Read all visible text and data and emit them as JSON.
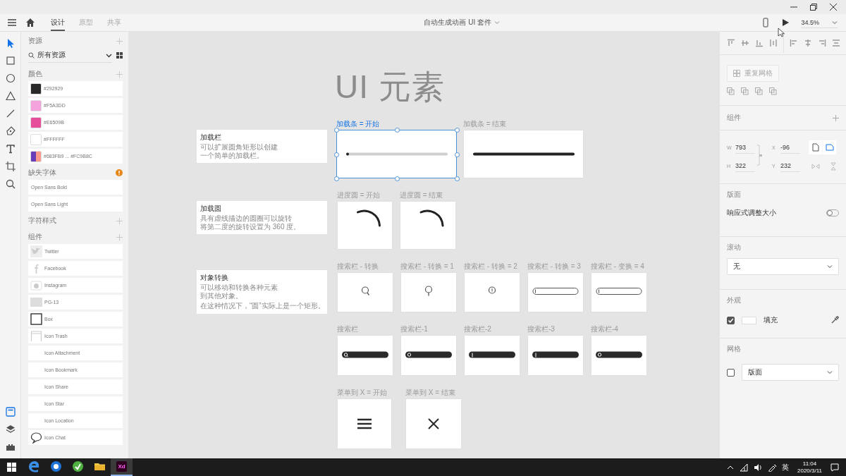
{
  "app_bar": {
    "tabs": [
      {
        "label": "设计",
        "selected": true
      },
      {
        "label": "原型",
        "selected": false
      },
      {
        "label": "共享",
        "selected": false
      }
    ],
    "document_title": "自动生成动画 UI 套件",
    "zoom": "34.5%"
  },
  "tools": [
    {
      "kind": "select",
      "selected": true
    },
    {
      "kind": "rectangle",
      "selected": false
    },
    {
      "kind": "ellipse",
      "selected": false
    },
    {
      "kind": "polygon",
      "selected": false
    },
    {
      "kind": "line",
      "selected": false
    },
    {
      "kind": "pen",
      "selected": false
    },
    {
      "kind": "text",
      "selected": false
    },
    {
      "kind": "artboard",
      "selected": false
    },
    {
      "kind": "zoom",
      "selected": false
    }
  ],
  "bottom_tools": [
    {
      "kind": "assets",
      "selected": true
    },
    {
      "kind": "layers",
      "selected": false
    },
    {
      "kind": "plugins",
      "selected": false
    }
  ],
  "assets": {
    "heading": "资源",
    "filter": "所有资源",
    "colors_heading": "颜色",
    "colors": [
      {
        "label": "#292929",
        "color": "#292929"
      },
      {
        "label": "#F5A3DD",
        "color": "#f5a3dd"
      },
      {
        "label": "#E6509B",
        "color": "#e6509b"
      },
      {
        "label": "#FFFFFF",
        "color": "#ffffff"
      },
      {
        "label": "#683FB9 ... #FC9B8C",
        "stops": [
          {
            "color": "#683fb9"
          },
          {
            "color": "#fc9b8c"
          }
        ]
      }
    ],
    "missing_fonts_heading": "缺失字体",
    "fonts": [
      "Open Sans Bold",
      "Open Sans Light"
    ],
    "char_styles_heading": "字符样式",
    "components_heading": "组件",
    "components": [
      {
        "label": "Twitter",
        "kind": "twitter"
      },
      {
        "label": "Facebook",
        "kind": "facebook"
      },
      {
        "label": "Instagram",
        "kind": "instagram"
      },
      {
        "label": "PG-13",
        "kind": "pg13"
      },
      {
        "label": "Box",
        "kind": "box"
      },
      {
        "label": "Icon Trash",
        "kind": "trash"
      },
      {
        "label": "Icon Attachment",
        "kind": "blank"
      },
      {
        "label": "Icon Bookmark",
        "kind": "blank"
      },
      {
        "label": "Icon Share",
        "kind": "blank"
      },
      {
        "label": "Icon Star",
        "kind": "blank"
      },
      {
        "label": "Icon Location",
        "kind": "blank"
      },
      {
        "label": "Icon Chat",
        "kind": "chat"
      }
    ]
  },
  "canvas": {
    "title": "UI 元素",
    "notes": [
      {
        "title": "加载栏",
        "lines": [
          "可以扩展圆角矩形以创建",
          "一个简单的加载栏。"
        ]
      },
      {
        "title": "加载圆",
        "lines": [
          "具有虚线描边的圆圈可以旋转",
          "将第二度的旋转设置为 360 度。"
        ]
      },
      {
        "title": "对象转换",
        "lines": [
          "可以移动和转换各种元素",
          "到其他对象。",
          "在这种情况下，“圆”实际上是一个矩形。"
        ]
      }
    ],
    "artboards": [
      {
        "label": "加载条 = 开始",
        "kind": "bar_start",
        "selected": true
      },
      {
        "label": "加载条 = 结束",
        "kind": "bar_end",
        "selected": false
      },
      {
        "label": "进度圆 = 开始",
        "kind": "arc",
        "selected": false
      },
      {
        "label": "进度圆 = 结束",
        "kind": "arc",
        "selected": false
      },
      {
        "label": "搜索栏 - 转换",
        "kind": "search_glass",
        "selected": false
      },
      {
        "label": "搜索栏 - 转换 = 1",
        "kind": "search_pin",
        "selected": false
      },
      {
        "label": "搜索栏 - 转换 = 2",
        "kind": "search_ring",
        "selected": false
      },
      {
        "label": "搜索栏 - 转换 = 3",
        "kind": "search_outline",
        "selected": false
      },
      {
        "label": "搜索栏 - 变换 = 4",
        "kind": "search_outline",
        "selected": false
      },
      {
        "label": "搜索栏",
        "kind": "searchbar_glass",
        "selected": false
      },
      {
        "label": "搜索栏-1",
        "kind": "searchbar_ring",
        "selected": false
      },
      {
        "label": "搜索栏-2",
        "kind": "searchbar_cursor",
        "selected": false
      },
      {
        "label": "搜索栏-3",
        "kind": "searchbar_cursor",
        "selected": false
      },
      {
        "label": "搜索栏-4",
        "kind": "searchbar_ring",
        "selected": false
      },
      {
        "label": "菜单到 X = 开始",
        "kind": "menu",
        "selected": false
      },
      {
        "label": "菜单到 X = 结束",
        "kind": "close",
        "selected": false
      }
    ]
  },
  "inspector": {
    "repeat_grid": "重复网格",
    "component_heading": "组件",
    "dims": [
      {
        "label": "W",
        "value": "793"
      },
      {
        "label": "X",
        "value": "-96"
      },
      {
        "label": "H",
        "value": "322"
      },
      {
        "label": "Y",
        "value": "232"
      }
    ],
    "artboard_heading": "版面",
    "responsive": {
      "label": "响应式调整大小",
      "on": false
    },
    "scroll_heading": "滚动",
    "scroll": "无",
    "appearance_heading": "外观",
    "fill": {
      "label": "填充",
      "checked": true,
      "color": "#ffffff"
    },
    "grid_heading": "网格",
    "grid": {
      "checked": false,
      "value": "版面"
    }
  },
  "taskbar": {
    "apps": [
      {
        "kind": "edge",
        "selected": false
      },
      {
        "kind": "blue",
        "selected": false
      },
      {
        "kind": "green",
        "selected": false
      },
      {
        "kind": "folder",
        "selected": false
      },
      {
        "kind": "xd",
        "label": "Xd",
        "selected": true
      }
    ],
    "ime": "英",
    "time": "11:04",
    "date": "2020/3/11"
  }
}
